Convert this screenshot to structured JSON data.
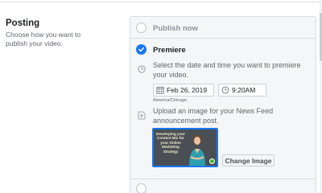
{
  "posting": {
    "title": "Posting",
    "description": "Choose how you want to publish your video."
  },
  "options": {
    "publish_now_label": "Publish now",
    "premiere_label": "Premiere",
    "premiere_desc": "Select the date and time you want to premiere your video.",
    "date_value": "Feb 26, 2019",
    "time_value": "9:20AM",
    "timezone": "America/Chicago",
    "upload_desc": "Upload an image for your News Feed announcement post.",
    "thumbnail_text": "Developing your Content Mix for your Online Marketing Strategy",
    "change_image_label": "Change Image"
  },
  "colors": {
    "accent": "#1877f2",
    "panel_bg": "#f5f6f7",
    "border": "#dadde1"
  },
  "icons": {
    "selected": "check-circle-icon",
    "clock": "clock-icon",
    "calendar": "calendar-icon",
    "upload": "image-upload-icon"
  }
}
